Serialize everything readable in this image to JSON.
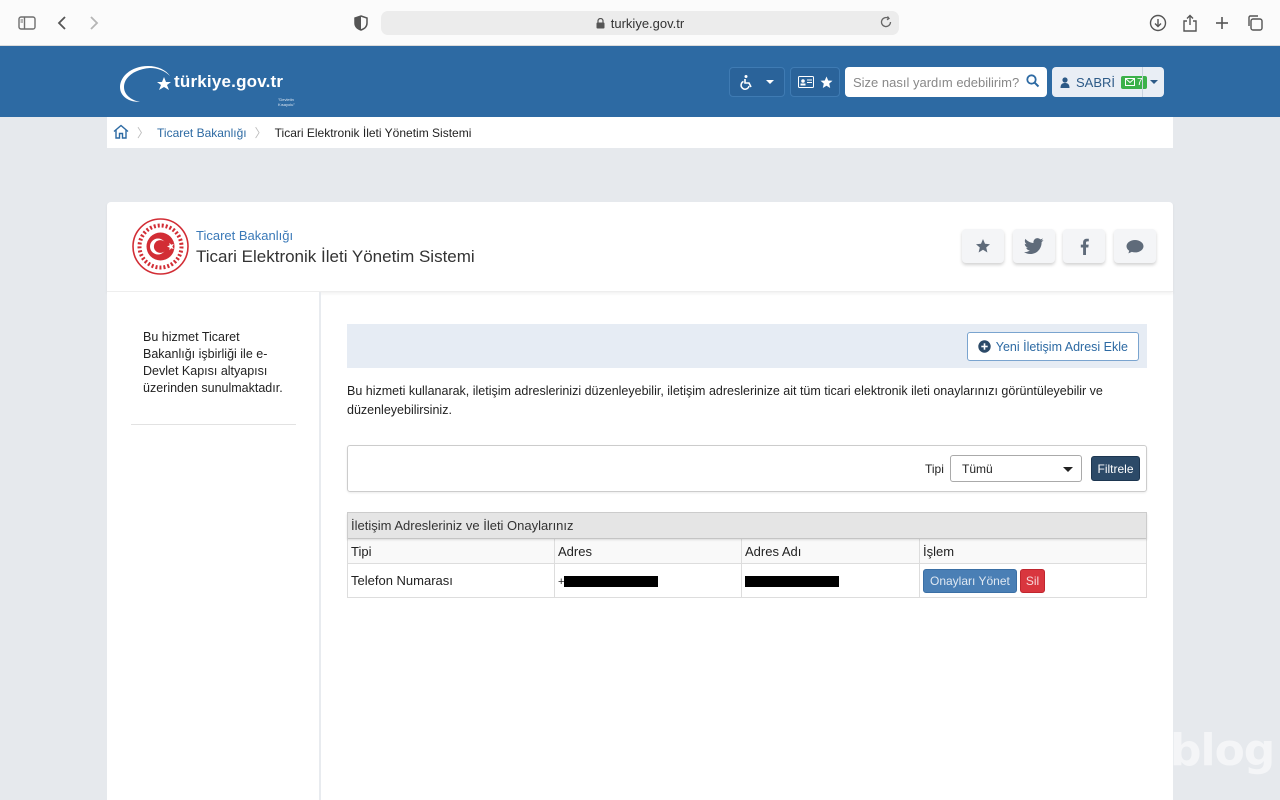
{
  "browser": {
    "url": "turkiye.gov.tr",
    "icons": [
      "sidebar-icon",
      "back-icon",
      "forward-icon",
      "shield-icon",
      "lock-icon",
      "reload-icon",
      "download-icon",
      "share-icon",
      "new-tab-icon",
      "tabs-icon"
    ]
  },
  "header": {
    "logo_text": "türkiye.gov.tr",
    "logo_sub": "\"Devletin Kısayolu\"",
    "search_placeholder": "Size nasıl yardım edebilirim?",
    "user_name": "SABRİ",
    "message_count": "7",
    "brand_color": "#2d6aa3"
  },
  "breadcrumb": {
    "items": [
      "Ticaret Bakanlığı",
      "Ticari Elektronik İleti Yönetim Sistemi"
    ]
  },
  "service": {
    "institution": "Ticaret Bakanlığı",
    "title": "Ticari Elektronik İleti Yönetim Sistemi"
  },
  "sidebar": {
    "note": "Bu hizmet Ticaret Bakanlığı işbirliği ile e-Devlet Kapısı altyapısı üzerinden sunulmaktadır."
  },
  "main": {
    "add_button": "Yeni İletişim Adresi Ekle",
    "intro": "Bu hizmeti kullanarak, iletişim adreslerinizi düzenleyebilir, iletişim adreslerinize ait tüm ticari elektronik ileti onaylarınızı görüntüleyebilir ve düzenleyebilirsiniz.",
    "filter": {
      "label": "Tipi",
      "selected": "Tümü",
      "button": "Filtrele"
    },
    "table": {
      "caption": "İletişim Adresleriniz ve İleti Onaylarınız",
      "headers": [
        "Tipi",
        "Adres",
        "Adres Adı",
        "İşlem"
      ],
      "rows": [
        {
          "type": "Telefon Numarası",
          "address_prefix": "+",
          "manage_button": "Onayları Yönet",
          "delete_button": "Sil"
        }
      ]
    }
  },
  "watermark": "blog"
}
